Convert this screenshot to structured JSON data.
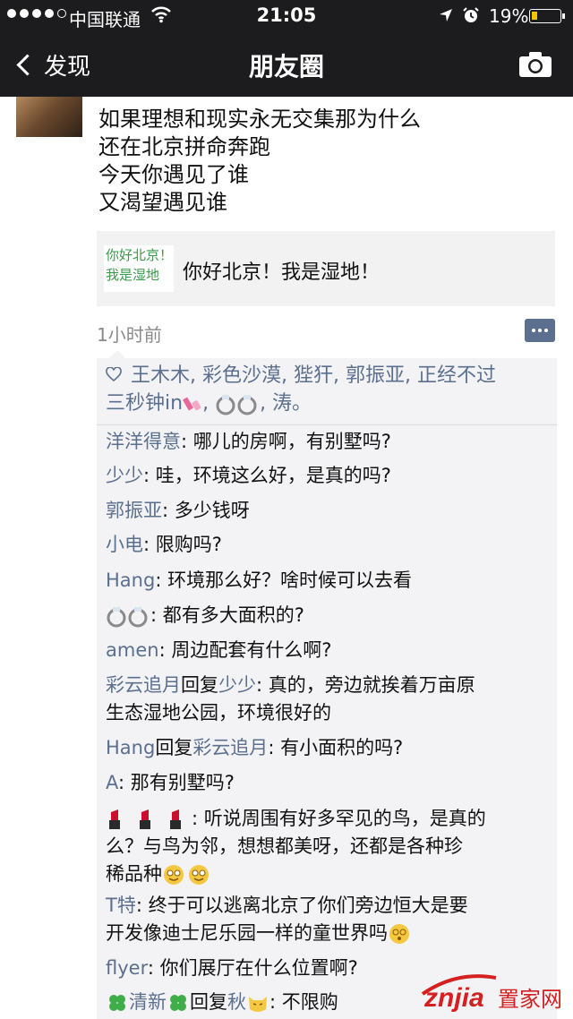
{
  "status_bar": {
    "carrier": "中国联通",
    "time": "21:05",
    "battery_pct": "19%",
    "battery_level": 0.19
  },
  "nav": {
    "back_label": "发现",
    "title": "朋友圈"
  },
  "post": {
    "text_lines": [
      "如果理想和现实永无交集那为什么",
      "还在北京拼命奔跑",
      "今天你遇见了谁",
      "又渴望遇见谁"
    ],
    "link": {
      "thumb_lines": [
        "你好北京！",
        "我是湿地"
      ],
      "title": "你好北京！我是湿地！"
    },
    "time": "1小时前"
  },
  "likes": {
    "line1": "王木木, 彩色沙漠, 狴犴, 郭振亚, 正经不过",
    "line2a": "三秒钟in",
    "line2b": ", 涛。"
  },
  "comments": [
    {
      "name": "洋洋得意",
      "text": ": 哪儿的房啊，有别墅吗?"
    },
    {
      "name": "少少",
      "text": ": 哇，环境这么好，是真的吗?"
    },
    {
      "name": "郭振亚",
      "text": ": 多少钱呀"
    },
    {
      "name": "小电",
      "text": ": 限购吗?"
    },
    {
      "name": "Hang",
      "text": ": 环境那么好？啥时候可以去看"
    },
    {
      "name": "",
      "text": ": 都有多大面积的?"
    },
    {
      "name": "amen",
      "text": ": 周边配套有什么啊?"
    },
    {
      "name": "彩云追月",
      "reply_word": "回复",
      "reply_to": "少少",
      "text": ": 真的，旁边就挨着万亩原",
      "text2": "生态湿地公园，环境很好的"
    },
    {
      "name": "Hang",
      "reply_word": "回复",
      "reply_to": "彩云追月",
      "text": ": 有小面积的吗?"
    },
    {
      "name": "A",
      "text": ": 那有别墅吗?"
    },
    {
      "name": "",
      "text": ": 听说周围有好多罕见的鸟，是真的",
      "text2": "么？与鸟为邻，想想都美呀，还都是各种珍",
      "text3": "稀品种"
    },
    {
      "name": "T特",
      "text": ": 终于可以逃离北京了你们旁边恒大是要",
      "text2": "开发像迪士尼乐园一样的童世界吗"
    },
    {
      "name": "flyer",
      "text": ": 你们展厅在什么位置啊?"
    },
    {
      "name": "清新",
      "reply_word": "回复",
      "reply_to": "秋",
      "text": ": 不限购"
    }
  ],
  "watermark": {
    "brand": "znjia",
    "cn": "置家网"
  },
  "colors": {
    "bar": "#1c1c1e",
    "name_blue": "#5b6f8e",
    "panel": "#f3f3f5",
    "watermark_red": "#d42020"
  }
}
